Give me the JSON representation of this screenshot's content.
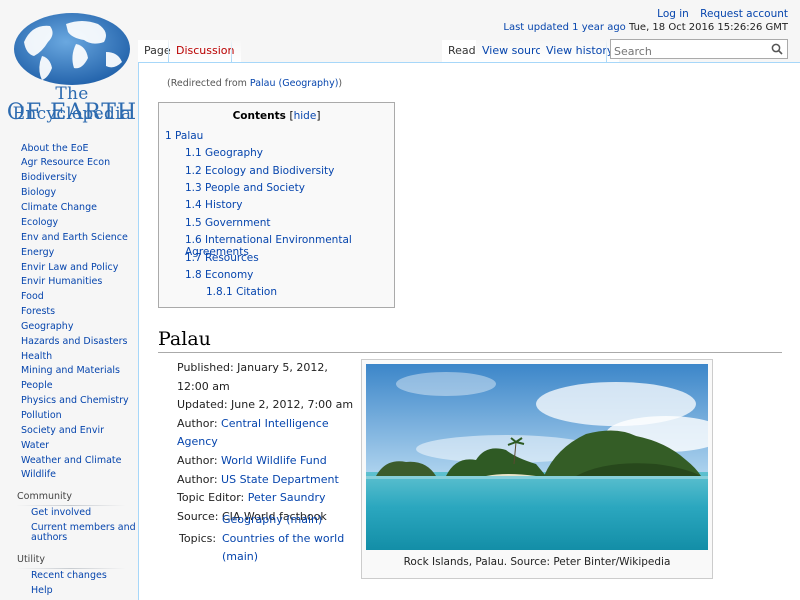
{
  "logo": {
    "line1": "The Encyclopedia",
    "line2": "OF EARTH"
  },
  "personal": {
    "login": "Log in",
    "request": "Request account",
    "updated_label": "Last updated 1 year ago",
    "updated_date": "Tue, 18 Oct 2016 15:26:26 GMT"
  },
  "tabs": {
    "page": "Page",
    "discussion": "Discussion",
    "read": "Read",
    "view_source": "View source",
    "view_history": "View history"
  },
  "search": {
    "placeholder": "Search"
  },
  "redirect": {
    "prefix": "(Redirected from ",
    "link": "Palau (Geography)",
    "suffix": ")"
  },
  "toc": {
    "title": "Contents",
    "hide_open": "[",
    "hide": "hide",
    "hide_close": "]",
    "items": [
      {
        "num": "1",
        "text": "Palau"
      },
      {
        "num": "1.1",
        "text": "Geography"
      },
      {
        "num": "1.2",
        "text": "Ecology and Biodiversity"
      },
      {
        "num": "1.3",
        "text": "People and Society"
      },
      {
        "num": "1.4",
        "text": "History"
      },
      {
        "num": "1.5",
        "text": "Government"
      },
      {
        "num": "1.6",
        "text": "International Environmental Agreements"
      },
      {
        "num": "1.7",
        "text": "Resources"
      },
      {
        "num": "1.8",
        "text": "Economy"
      },
      {
        "num": "1.8.1",
        "text": "Citation"
      }
    ]
  },
  "article": {
    "heading": "Palau",
    "published": "Published: January 5, 2012, 12:00 am",
    "updated": "Updated: June 2, 2012, 7:00 am",
    "author_label": "Author: ",
    "author1": "Central Intelligence Agency",
    "author2": "World Wildlife Fund",
    "author3": "US State Department",
    "editor_label": "Topic Editor: ",
    "editor": "Peter Saundry",
    "source": "Source: CIA World factbook",
    "topics_label": "Topics:",
    "topic1": "Geography (main)",
    "topic2": "Countries of the world (main)",
    "caption": "Rock Islands, Palau. Source: Peter Binter/Wikipedia"
  },
  "sidebar": {
    "nav": [
      "About the EoE",
      "Agr Resource Econ",
      "Biodiversity",
      "Biology",
      "Climate Change",
      "Ecology",
      "Env and Earth Science",
      "Energy",
      "Envir Law and Policy",
      "Envir Humanities",
      "Food",
      "Forests",
      "Geography",
      "Hazards and Disasters",
      "Health",
      "Mining and Materials",
      "People",
      "Physics and Chemistry",
      "Pollution",
      "Society and Envir",
      "Water",
      "Weather and Climate",
      "Wildlife"
    ],
    "community_head": "Community",
    "community": [
      "Get involved",
      "Current members and",
      "authors"
    ],
    "utility_head": "Utility",
    "utility": [
      "Recent changes",
      "Help"
    ]
  },
  "colors": {
    "link": "#0645ad",
    "new_link": "#ba0000",
    "logo_blue": "#2d6bb0"
  },
  "icons": {
    "search": "search-icon",
    "globe": "globe-logo"
  }
}
